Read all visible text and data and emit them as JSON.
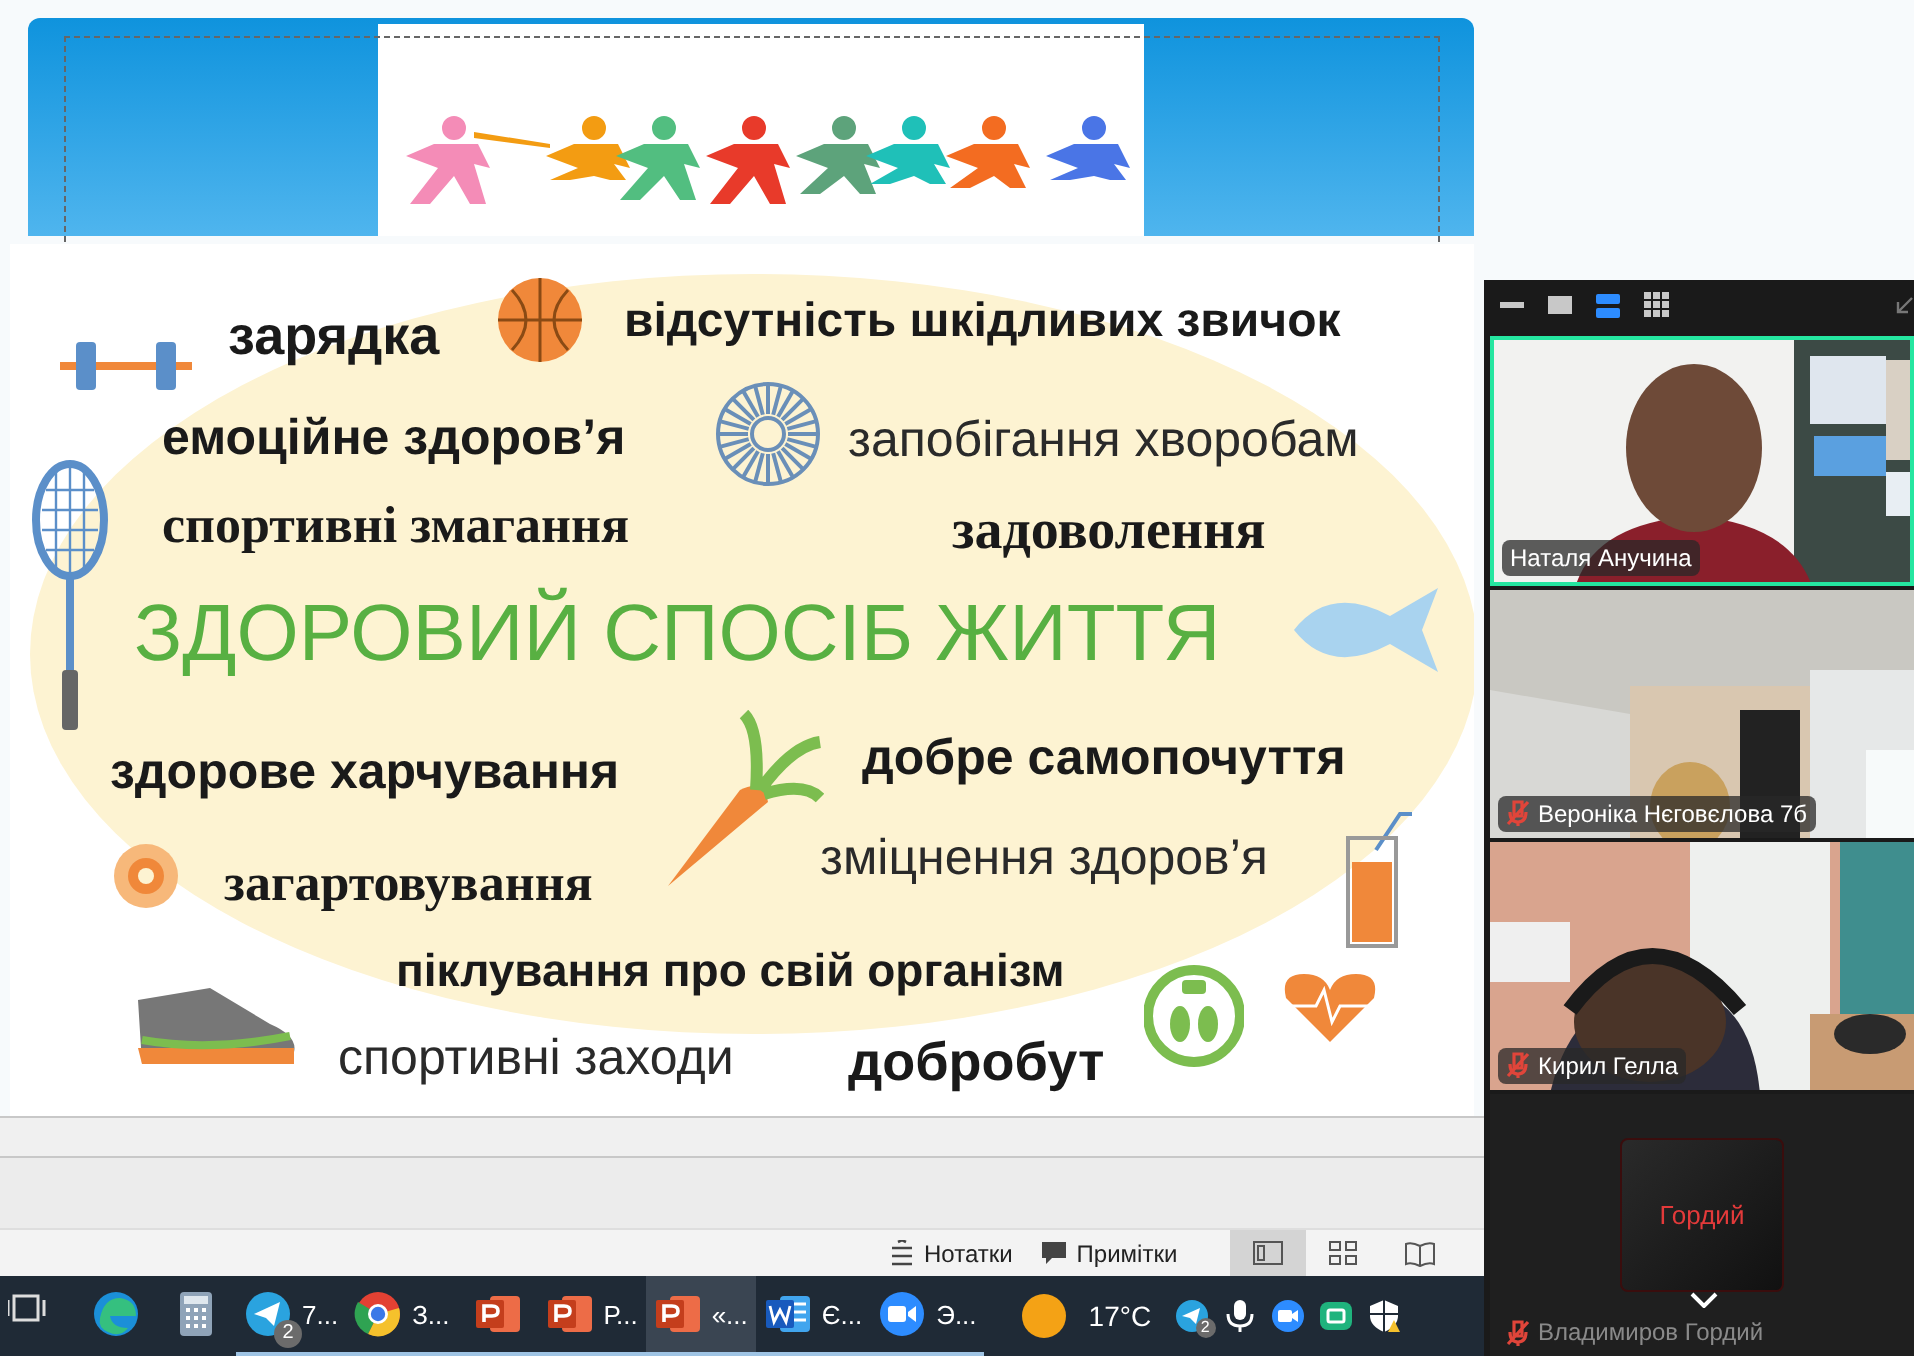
{
  "slide": {
    "words": [
      "зарядка",
      "відсутність шкідливих звичок",
      "емоційне здоров’я",
      "запобігання хворобам",
      "спортивні змагання",
      "задоволення",
      "ЗДОРОВИЙ СПОСІБ ЖИТТЯ",
      "здорове харчування",
      "добре самопочуття",
      "зміцнення здоров’я",
      "загартовування",
      "піклування про свій організм",
      "спортивні заходи",
      "добробут"
    ]
  },
  "status_bar": {
    "buttons": [
      {
        "label": "Нотатки",
        "kind": "notes"
      },
      {
        "label": "Примітки",
        "kind": "comments"
      }
    ],
    "views": [
      {
        "kind": "normal",
        "selected": true
      },
      {
        "kind": "sorter",
        "selected": false
      },
      {
        "kind": "reading",
        "selected": false
      }
    ]
  },
  "video_panel": {
    "view_modes": [
      {
        "kind": "minimize",
        "selected": false
      },
      {
        "kind": "single",
        "selected": false
      },
      {
        "kind": "speaker",
        "selected": true
      },
      {
        "kind": "gallery",
        "selected": false
      }
    ],
    "tiles": [
      {
        "name": "Наталя Анучина",
        "kind": "video",
        "muted": false,
        "speaking": true
      },
      {
        "name": "Вероніка Нєговєлова 7б",
        "kind": "video",
        "muted": true,
        "speaking": false
      },
      {
        "name": "Кирил Гелла",
        "kind": "video",
        "muted": true,
        "speaking": false
      },
      {
        "name": "Владимиров Гордий",
        "kind": "avatar",
        "avatar_text": "Гордий",
        "muted": true,
        "speaking": false,
        "dimmed": true
      }
    ]
  },
  "taskbar": {
    "apps": [
      {
        "kind": "task-view",
        "running": false,
        "selected": false
      },
      {
        "kind": "edge",
        "running": false,
        "selected": false
      },
      {
        "kind": "calculator",
        "running": false,
        "selected": false
      },
      {
        "kind": "telegram",
        "label": "7...",
        "badge": "2",
        "running": true,
        "selected": false
      },
      {
        "kind": "chrome",
        "label": "З...",
        "running": true,
        "selected": false
      },
      {
        "kind": "powerpoint",
        "running": true,
        "selected": false
      },
      {
        "kind": "powerpoint",
        "label": "Р...",
        "running": true,
        "selected": false
      },
      {
        "kind": "powerpoint",
        "label": "«...",
        "running": true,
        "selected": true
      },
      {
        "kind": "word",
        "label": "Є...",
        "running": true,
        "selected": false
      },
      {
        "kind": "zoom",
        "label": "Э...",
        "running": true,
        "selected": false
      }
    ],
    "weather": {
      "temperature": "17°C"
    },
    "tray": [
      {
        "kind": "telegram",
        "badge": "2"
      },
      {
        "kind": "mic"
      },
      {
        "kind": "zoom"
      },
      {
        "kind": "app"
      },
      {
        "kind": "shield"
      }
    ]
  }
}
